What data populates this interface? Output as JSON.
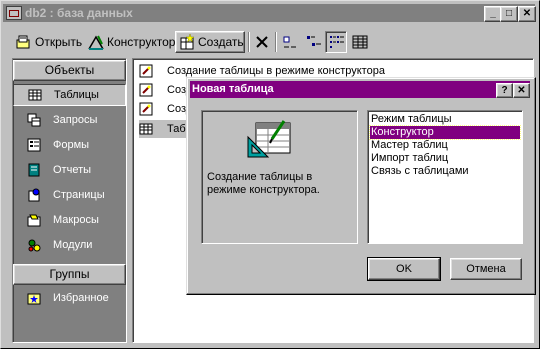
{
  "window": {
    "title": "db2 : база данных",
    "minimize": "_",
    "maximize": "□",
    "close": "✕"
  },
  "toolbar": {
    "open_label": "Открыть",
    "constructor_label": "Конструктор",
    "create_label": "Создать"
  },
  "left_panel": {
    "objects_header": "Объекты",
    "items": [
      {
        "label": "Таблицы",
        "icon": "table-icon"
      },
      {
        "label": "Запросы",
        "icon": "query-icon"
      },
      {
        "label": "Формы",
        "icon": "form-icon"
      },
      {
        "label": "Отчеты",
        "icon": "report-icon"
      },
      {
        "label": "Страницы",
        "icon": "page-icon"
      },
      {
        "label": "Макросы",
        "icon": "macro-icon"
      },
      {
        "label": "Модули",
        "icon": "module-icon"
      }
    ],
    "groups_header": "Группы",
    "favorites": "Избранное"
  },
  "list": {
    "items": [
      {
        "label": "Создание таблицы в режиме конструктора"
      },
      {
        "label": "Созд"
      },
      {
        "label": "Созд"
      },
      {
        "label": "Таб"
      }
    ]
  },
  "dialog": {
    "title": "Новая таблица",
    "help": "?",
    "close": "✕",
    "description": "Создание таблицы в режиме конструктора.",
    "options": [
      "Режим таблицы",
      "Конструктор",
      "Мастер таблиц",
      "Импорт таблиц",
      "Связь с таблицами"
    ],
    "selected_option": "Конструктор",
    "ok_label": "OK",
    "cancel_label": "Отмена"
  },
  "colors": {
    "dialog_title_bg": "#800080",
    "inactive_title_bg": "#808080",
    "selection": "#800080",
    "face": "#c0c0c0"
  }
}
